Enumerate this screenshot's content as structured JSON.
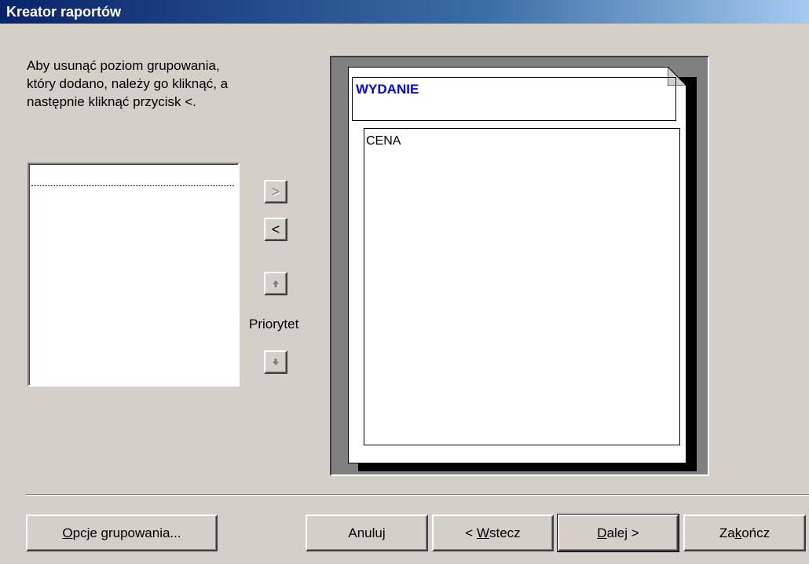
{
  "window": {
    "title": "Kreator raportów"
  },
  "instructions": "Aby usunąć poziom grupowania,\nktóry dodano, należy go kliknąć, a\nnastępnie kliknąć przycisk <.",
  "fields_list": {
    "items": [
      ""
    ]
  },
  "move_buttons": {
    "add_label": ">",
    "remove_label": "<"
  },
  "priority": {
    "label": "Priorytet"
  },
  "preview": {
    "group_level": "WYDANIE",
    "detail_field": "CENA"
  },
  "footer": {
    "options": {
      "label": "Opcje grupowania...",
      "mnemonic": "O",
      "rest": "pcje grupowania..."
    },
    "cancel": {
      "label": "Anuluj"
    },
    "back": {
      "before": "< ",
      "mnemonic": "W",
      "rest": "stecz"
    },
    "next": {
      "mnemonic": "D",
      "rest": "alej >"
    },
    "finish": {
      "before": "Za",
      "mnemonic": "k",
      "rest": "ończ"
    }
  },
  "colors": {
    "titlebar_start": "#0a246a",
    "titlebar_end": "#a6caf0",
    "dialog_bg": "#d4d0c8",
    "group_label": "#0000ff"
  },
  "icons": {
    "priority_up": "arrow-up-icon",
    "priority_down": "arrow-down-icon",
    "page_fold": "page-fold-icon"
  }
}
